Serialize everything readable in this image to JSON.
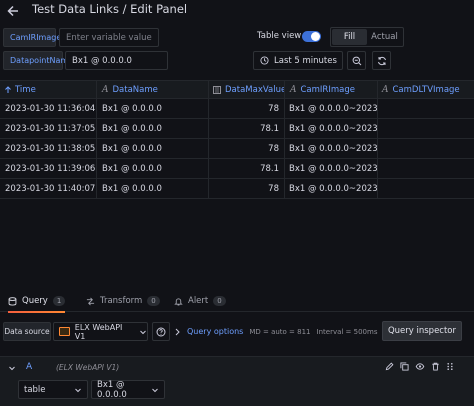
{
  "header": {
    "title": "Test Data Links / Edit Panel"
  },
  "variables": [
    {
      "label": "CamIRImage",
      "value": "",
      "placeholder": "Enter variable value"
    },
    {
      "label": "DatapointName",
      "value": "Bx1 @ 0.0.0.0",
      "placeholder": ""
    }
  ],
  "controls": {
    "table_view_label": "Table view",
    "table_view_on": true,
    "fill_label": "Fill",
    "actual_label": "Actual",
    "time_range": "Last 5 minutes"
  },
  "table": {
    "columns": [
      "Time",
      "DataName",
      "DataMaxValue",
      "CamIRImage",
      "CamDLTVImage"
    ],
    "rows": [
      [
        "2023-01-30 11:36:04",
        "Bx1 @ 0.0.0.0",
        "78",
        "Bx1 @ 0.0.0.0~2023~..."
      ],
      [
        "2023-01-30 11:37:05",
        "Bx1 @ 0.0.0.0",
        "78.1",
        "Bx1 @ 0.0.0.0~2023~..."
      ],
      [
        "2023-01-30 11:38:05",
        "Bx1 @ 0.0.0.0",
        "78",
        "Bx1 @ 0.0.0.0~2023~..."
      ],
      [
        "2023-01-30 11:39:06",
        "Bx1 @ 0.0.0.0",
        "78.1",
        "Bx1 @ 0.0.0.0~2023~..."
      ],
      [
        "2023-01-30 11:40:07",
        "Bx1 @ 0.0.0.0",
        "78",
        "Bx1 @ 0.0.0.0~2023~..."
      ]
    ]
  },
  "tabs": [
    {
      "label": "Query",
      "count": "1",
      "active": true
    },
    {
      "label": "Transform",
      "count": "0",
      "active": false
    },
    {
      "label": "Alert",
      "count": "0",
      "active": false
    }
  ],
  "datasource": {
    "label": "Data source",
    "name": "ELX WebAPI V1",
    "query_options_label": "Query options",
    "md": "MD = auto = 811",
    "interval": "Interval = 500ms",
    "inspector_label": "Query inspector"
  },
  "query": {
    "name": "A",
    "datasource": "(ELX WebAPI V1)",
    "format": "table",
    "datapoint": "Bx1 @ 0.0.0.0"
  },
  "colors": {
    "accent_blue": "#6e9fff",
    "toggle": "#3d71d9",
    "tab_underline": "#f55f3e",
    "background": "#111217"
  }
}
